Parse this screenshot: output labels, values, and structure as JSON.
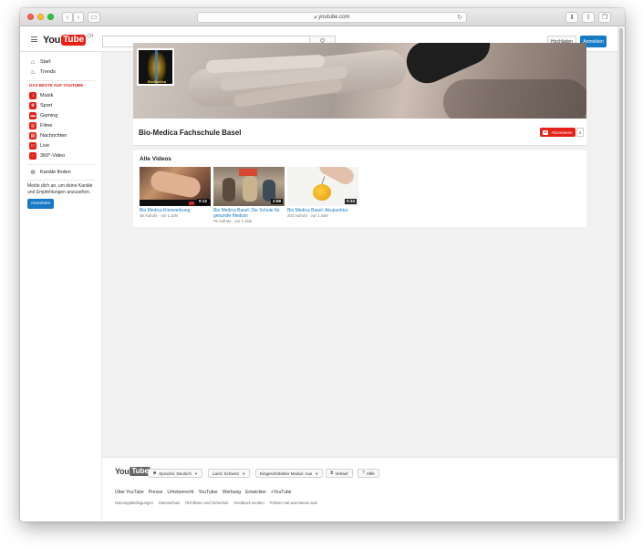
{
  "browser": {
    "url": "youtube.com"
  },
  "header": {
    "logo_you": "You",
    "logo_tube": "Tube",
    "country": "CH",
    "search_placeholder": "",
    "upload_label": "Hochladen",
    "signin_label": "Anmelden"
  },
  "sidebar": {
    "main": [
      {
        "label": "Start",
        "icon": "home-icon"
      },
      {
        "label": "Trends",
        "icon": "flame-icon"
      }
    ],
    "best_heading": "DAS BESTE AUF YOUTUBE",
    "best": [
      {
        "label": "Musik",
        "icon": "music-icon"
      },
      {
        "label": "Sport",
        "icon": "trophy-icon"
      },
      {
        "label": "Gaming",
        "icon": "gamepad-icon"
      },
      {
        "label": "Filme",
        "icon": "film-icon"
      },
      {
        "label": "Nachrichten",
        "icon": "news-icon"
      },
      {
        "label": "Live",
        "icon": "live-icon"
      },
      {
        "label": "360°-Video",
        "icon": "360-icon"
      }
    ],
    "browse_channels": "Kanäle finden",
    "signin_message": "Melde dich an, um deine Kanäle und Empfehlungen anzusehen.",
    "signin_label": "Anmelden"
  },
  "channel": {
    "avatar_label": "BioMedica",
    "title": "Bio-Medica Fachschule Basel",
    "subscribe_label": "Abonnieren",
    "subscriber_count": "3"
  },
  "videos": {
    "section_title": "Alle Videos",
    "items": [
      {
        "title": "Bio Medica Kinowerbung",
        "meta": "48 Aufrufe · vor 1 Jahr",
        "duration": "0:12"
      },
      {
        "title": "Bio Medica Basel: Die Schule für gesunde Medizin",
        "meta": "76 Aufrufe · vor 1 Jahr",
        "duration": "2:58"
      },
      {
        "title": "Bio Medica Basel: Akupunktur",
        "meta": "203 Aufrufe · vor 1 Jahr",
        "duration": "0:34"
      }
    ]
  },
  "footer": {
    "logo_you": "You",
    "logo_tube": "Tube",
    "language": "Sprache: Deutsch",
    "country": "Land: Schweiz",
    "restricted": "Eingeschränkter Modus: Aus",
    "history": "Verlauf",
    "help": "Hilfe",
    "links": [
      "Über YouTube",
      "Presse",
      "Urheberrecht",
      "YouTuber",
      "Werbung",
      "Entwickler",
      "+YouTube"
    ],
    "links2": [
      "Nutzungsbedingungen",
      "Datenschutz",
      "Richtlinien und Sicherheit",
      "Feedback senden",
      "Probier mal was Neues aus!"
    ]
  },
  "colors": {
    "brand_red": "#e62117",
    "link_blue": "#167ac6"
  }
}
